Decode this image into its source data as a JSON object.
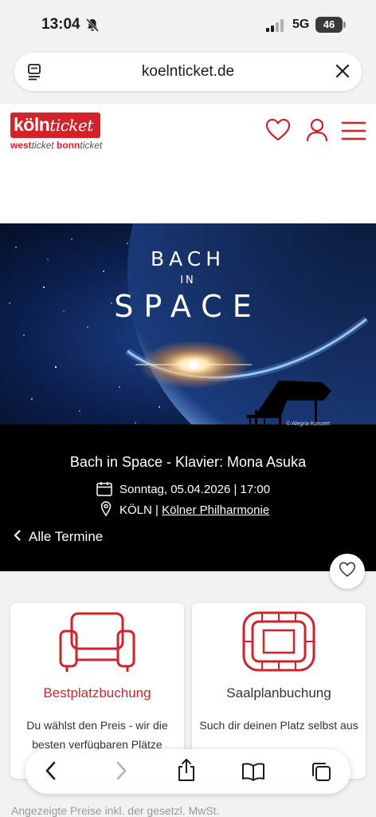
{
  "status_bar": {
    "time": "13:04",
    "network": "5G",
    "battery": "46"
  },
  "browser": {
    "url": "koelnticket.de"
  },
  "site": {
    "logo_main_bold": "köln",
    "logo_main_italic": "ticket",
    "logo_sub_1": "west",
    "logo_sub_1_it": "ticket",
    "logo_sub_2": "bonn",
    "logo_sub_2_it": "ticket",
    "brand_color": "#d2232a"
  },
  "hero": {
    "line1": "BACH",
    "line2": "IN",
    "line3": "SPACE",
    "credit": "© Alegria Konzert"
  },
  "event": {
    "title": "Bach in Space - Klavier: Mona Asuka",
    "date": "Sonntag, 05.04.2026 | 17:00",
    "city": "KÖLN | ",
    "venue": "Kölner Philharmonie",
    "back_label": "Alle Termine"
  },
  "cards": [
    {
      "title": "Bestplatzbuchung",
      "desc": "Du wählst den Preis - wir die besten verfügbaren Plätze",
      "icon": "armchair-icon",
      "title_color": "#d2232a"
    },
    {
      "title": "Saalplanbuchung",
      "desc": "Such dir deinen Platz selbst aus",
      "icon": "hall-plan-icon",
      "title_color": "#333333"
    }
  ],
  "footer": {
    "note": "Angezeigte Preise inkl. der gesetzl. MwSt."
  }
}
